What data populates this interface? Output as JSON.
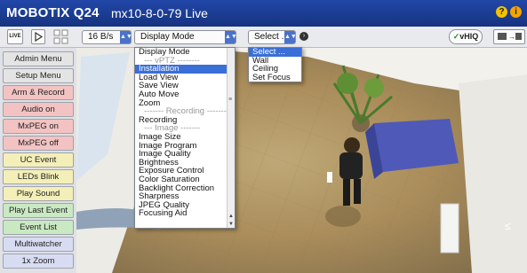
{
  "title": {
    "brand": "MOBOTIX Q24",
    "camera": "mx10-8-0-79 Live"
  },
  "title_icons": [
    "help-icon",
    "info-icon"
  ],
  "toolbar": {
    "live_label": "LIVE",
    "frame_rate": "16 B/s",
    "display_mode": "Display Mode",
    "view_select": "Select ...",
    "vhiq_label": "vHIQ"
  },
  "sidebar": [
    {
      "label": "Admin Menu",
      "color": "#e4e4e4"
    },
    {
      "label": "Setup Menu",
      "color": "#e4e4e4"
    },
    {
      "label": "Arm & Record",
      "color": "#f3c3c3"
    },
    {
      "label": "Audio on",
      "color": "#f3c3c3"
    },
    {
      "label": "MxPEG on",
      "color": "#f3c3c3"
    },
    {
      "label": "MxPEG off",
      "color": "#f3c3c3"
    },
    {
      "label": "UC Event",
      "color": "#f4efb8"
    },
    {
      "label": "LEDs Blink",
      "color": "#f4efb8"
    },
    {
      "label": "Play Sound",
      "color": "#f4efb8"
    },
    {
      "label": "Play Last Event",
      "color": "#c9e9c2"
    },
    {
      "label": "Event List",
      "color": "#c9e9c2"
    },
    {
      "label": "Multiwatcher",
      "color": "#d8dcf2"
    },
    {
      "label": "1x Zoom",
      "color": "#d8dcf2"
    }
  ],
  "display_mode_menu": [
    "Display Mode",
    "--- vPTZ --------",
    "Installation",
    "Load View",
    "Save View",
    "Auto Move",
    "Zoom",
    "------- Recording -------",
    "Recording",
    "--- Image -------",
    "Image Size",
    "Image Program",
    "Image Quality",
    "Brightness",
    "Exposure Control",
    "Color Saturation",
    "Backlight Correction",
    "Sharpness",
    "JPEG Quality",
    "Focusing Aid"
  ],
  "display_mode_selected": "Installation",
  "view_menu": [
    "Select ...",
    "Wall",
    "Ceiling",
    "Set Focus"
  ],
  "view_menu_selected": "Select ...",
  "colors": {
    "title_bar": "#1c3e96",
    "accent": "#3a6fd8"
  }
}
